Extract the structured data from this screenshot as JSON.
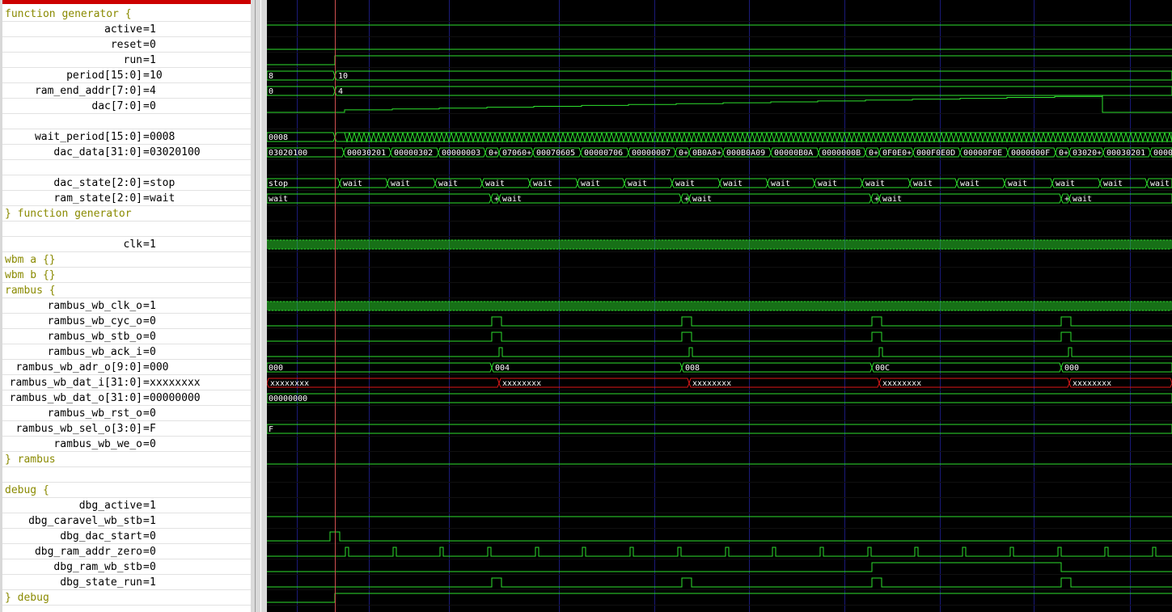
{
  "rows": [
    {
      "kind": "group",
      "label": "function generator {"
    },
    {
      "kind": "sig",
      "name": "active",
      "value": "1"
    },
    {
      "kind": "sig",
      "name": "reset",
      "value": "0"
    },
    {
      "kind": "sig",
      "name": "run",
      "value": "1"
    },
    {
      "kind": "sig",
      "name": "period[15:0]",
      "value": "10"
    },
    {
      "kind": "sig",
      "name": "ram_end_addr[7:0]",
      "value": "4"
    },
    {
      "kind": "sig",
      "name": "dac[7:0]",
      "value": "0"
    },
    {
      "kind": "blank"
    },
    {
      "kind": "sig",
      "name": "wait_period[15:0]",
      "value": "0008"
    },
    {
      "kind": "sig",
      "name": "dac_data[31:0]",
      "value": "03020100"
    },
    {
      "kind": "blank"
    },
    {
      "kind": "sig",
      "name": "dac_state[2:0]",
      "value": "stop"
    },
    {
      "kind": "sig",
      "name": "ram_state[2:0]",
      "value": "wait"
    },
    {
      "kind": "group",
      "label": "} function generator"
    },
    {
      "kind": "blank"
    },
    {
      "kind": "sig",
      "name": "clk",
      "value": "1"
    },
    {
      "kind": "group",
      "label": "wbm a {}"
    },
    {
      "kind": "group",
      "label": "wbm b {}"
    },
    {
      "kind": "group",
      "label": "rambus {"
    },
    {
      "kind": "sig",
      "name": "rambus_wb_clk_o",
      "value": "1"
    },
    {
      "kind": "sig",
      "name": "rambus_wb_cyc_o",
      "value": "0"
    },
    {
      "kind": "sig",
      "name": "rambus_wb_stb_o",
      "value": "0"
    },
    {
      "kind": "sig",
      "name": "rambus_wb_ack_i",
      "value": "0"
    },
    {
      "kind": "sig",
      "name": "rambus_wb_adr_o[9:0]",
      "value": "000"
    },
    {
      "kind": "sig",
      "name": "rambus_wb_dat_i[31:0]",
      "value": "xxxxxxxx"
    },
    {
      "kind": "sig",
      "name": "rambus_wb_dat_o[31:0]",
      "value": "00000000"
    },
    {
      "kind": "sig",
      "name": "rambus_wb_rst_o",
      "value": "0"
    },
    {
      "kind": "sig",
      "name": "rambus_wb_sel_o[3:0]",
      "value": "F"
    },
    {
      "kind": "sig",
      "name": "rambus_wb_we_o",
      "value": "0"
    },
    {
      "kind": "group",
      "label": "} rambus"
    },
    {
      "kind": "blank"
    },
    {
      "kind": "group",
      "label": "debug {"
    },
    {
      "kind": "sig",
      "name": "dbg_active",
      "value": "1"
    },
    {
      "kind": "sig",
      "name": "dbg_caravel_wb_stb",
      "value": "1"
    },
    {
      "kind": "sig",
      "name": "dbg_dac_start",
      "value": "0"
    },
    {
      "kind": "sig",
      "name": "dbg_ram_addr_zero",
      "value": "0"
    },
    {
      "kind": "sig",
      "name": "dbg_ram_wb_stb",
      "value": "0"
    },
    {
      "kind": "sig",
      "name": "dbg_state_run",
      "value": "1"
    },
    {
      "kind": "group",
      "label": "} debug"
    }
  ],
  "bus_labels": {
    "period": [
      "8",
      "10"
    ],
    "ram_end_addr": [
      "0",
      "4"
    ],
    "wait_period": [
      "0008"
    ],
    "dac_data": [
      "03020100",
      "00030201",
      "00000302",
      "00000003",
      "0+",
      "07060+",
      "00070605",
      "00000706",
      "00000007",
      "0+",
      "0B0A0+",
      "000B0A09",
      "00000B0A",
      "0000000B",
      "0+",
      "0F0E0+",
      "000F0E0D",
      "00000F0E",
      "0000000F",
      "0+",
      "03020+",
      "00030201",
      "0000"
    ],
    "dac_state": [
      "stop",
      "wait"
    ],
    "ram_state": [
      "wait",
      "+",
      "wait"
    ],
    "adr": [
      "000",
      "004",
      "008",
      "00C",
      "000"
    ],
    "dat_i": [
      "xxxxxxxx"
    ],
    "dat_o": [
      "00000000"
    ],
    "sel": [
      "F"
    ]
  },
  "colors": {
    "background": "#000000",
    "trace": "#2ee02e",
    "unknown": "#e01818",
    "grid": "#1a1a78",
    "cursor": "#d05050",
    "group_text": "#8a8a00",
    "label_text": "#ffffff"
  }
}
